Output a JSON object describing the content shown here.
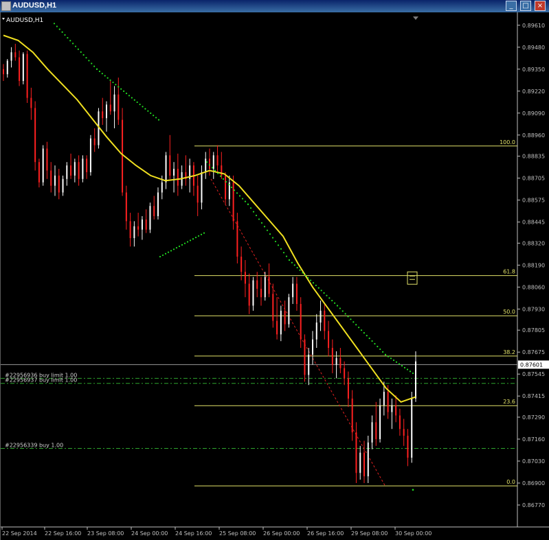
{
  "window": {
    "title": "AUDUSD,H1",
    "min_glyph": "_",
    "max_glyph": "□",
    "close_glyph": "×"
  },
  "chart_data": {
    "type": "candlestick",
    "symbol_label": "AUDUSD,H1",
    "ylim": [
      0.8664,
      0.8967
    ],
    "y_ticks": [
      "0.89610",
      "0.89480",
      "0.89350",
      "0.89220",
      "0.89090",
      "0.88960",
      "0.88835",
      "0.88705",
      "0.88575",
      "0.88445",
      "0.88320",
      "0.88190",
      "0.88060",
      "0.87930",
      "0.87805",
      "0.87675",
      "0.87545",
      "0.87415",
      "0.87290",
      "0.87160",
      "0.87030",
      "0.86900",
      "0.86770"
    ],
    "x_ticks": [
      "22 Sep 2014",
      "22 Sep 16:00",
      "23 Sep 08:00",
      "24 Sep 00:00",
      "24 Sep 16:00",
      "25 Sep 08:00",
      "26 Sep 00:00",
      "26 Sep 16:00",
      "29 Sep 08:00",
      "30 Sep 00:00"
    ],
    "current_price": "0.87601",
    "candles": [
      [
        0.8935,
        0.8938,
        0.8928,
        0.8932
      ],
      [
        0.8932,
        0.8941,
        0.893,
        0.894
      ],
      [
        0.894,
        0.8948,
        0.8936,
        0.8945
      ],
      [
        0.8945,
        0.895,
        0.894,
        0.8942
      ],
      [
        0.8942,
        0.8946,
        0.8925,
        0.8928
      ],
      [
        0.8928,
        0.8945,
        0.8926,
        0.8944
      ],
      [
        0.8944,
        0.8946,
        0.8915,
        0.8918
      ],
      [
        0.8918,
        0.8924,
        0.8905,
        0.8912
      ],
      [
        0.8912,
        0.8916,
        0.8875,
        0.888
      ],
      [
        0.888,
        0.8882,
        0.8865,
        0.8868
      ],
      [
        0.8868,
        0.889,
        0.8866,
        0.8888
      ],
      [
        0.8888,
        0.8892,
        0.887,
        0.8875
      ],
      [
        0.8875,
        0.888,
        0.8862,
        0.8866
      ],
      [
        0.8866,
        0.8878,
        0.886,
        0.8872
      ],
      [
        0.8872,
        0.8876,
        0.8858,
        0.8862
      ],
      [
        0.8862,
        0.8872,
        0.886,
        0.887
      ],
      [
        0.887,
        0.888,
        0.8866,
        0.8878
      ],
      [
        0.8878,
        0.8885,
        0.887,
        0.8872
      ],
      [
        0.8872,
        0.8882,
        0.8868,
        0.888
      ],
      [
        0.888,
        0.8884,
        0.8866,
        0.887
      ],
      [
        0.887,
        0.8884,
        0.8868,
        0.8882
      ],
      [
        0.8882,
        0.8884,
        0.887,
        0.8874
      ],
      [
        0.8874,
        0.8896,
        0.8872,
        0.8894
      ],
      [
        0.8894,
        0.89,
        0.8886,
        0.889
      ],
      [
        0.889,
        0.8912,
        0.8888,
        0.891
      ],
      [
        0.891,
        0.8918,
        0.8902,
        0.8906
      ],
      [
        0.8906,
        0.8916,
        0.8898,
        0.8914
      ],
      [
        0.8914,
        0.8928,
        0.8908,
        0.891
      ],
      [
        0.891,
        0.8925,
        0.89,
        0.892
      ],
      [
        0.892,
        0.893,
        0.8902,
        0.8905
      ],
      [
        0.8905,
        0.8912,
        0.886,
        0.8862
      ],
      [
        0.8862,
        0.8866,
        0.884,
        0.8845
      ],
      [
        0.8845,
        0.885,
        0.883,
        0.8835
      ],
      [
        0.8835,
        0.8845,
        0.883,
        0.8842
      ],
      [
        0.8842,
        0.885,
        0.8836,
        0.884
      ],
      [
        0.884,
        0.8848,
        0.8834,
        0.8846
      ],
      [
        0.8846,
        0.8852,
        0.8838,
        0.884
      ],
      [
        0.884,
        0.8856,
        0.8838,
        0.8854
      ],
      [
        0.8854,
        0.886,
        0.8846,
        0.8848
      ],
      [
        0.8848,
        0.8865,
        0.8846,
        0.8862
      ],
      [
        0.8862,
        0.8872,
        0.8858,
        0.8868
      ],
      [
        0.8868,
        0.8886,
        0.8864,
        0.8884
      ],
      [
        0.8884,
        0.8896,
        0.887,
        0.8872
      ],
      [
        0.8872,
        0.888,
        0.8862,
        0.8876
      ],
      [
        0.8876,
        0.8885,
        0.886,
        0.8866
      ],
      [
        0.8866,
        0.8878,
        0.8864,
        0.8874
      ],
      [
        0.8874,
        0.8884,
        0.8866,
        0.887
      ],
      [
        0.887,
        0.8882,
        0.8862,
        0.8878
      ],
      [
        0.8878,
        0.888,
        0.886,
        0.8866
      ],
      [
        0.8866,
        0.8872,
        0.8848,
        0.8856
      ],
      [
        0.8856,
        0.8878,
        0.8852,
        0.8874
      ],
      [
        0.8874,
        0.8886,
        0.887,
        0.8882
      ],
      [
        0.8882,
        0.8888,
        0.8872,
        0.8876
      ],
      [
        0.8876,
        0.8886,
        0.887,
        0.8884
      ],
      [
        0.8884,
        0.889,
        0.8874,
        0.8878
      ],
      [
        0.8878,
        0.8886,
        0.887,
        0.8872
      ],
      [
        0.8872,
        0.8874,
        0.8855,
        0.8858
      ],
      [
        0.8858,
        0.8872,
        0.8854,
        0.8868
      ],
      [
        0.8868,
        0.8872,
        0.884,
        0.8845
      ],
      [
        0.8845,
        0.885,
        0.882,
        0.8824
      ],
      [
        0.8824,
        0.883,
        0.881,
        0.8815
      ],
      [
        0.8815,
        0.8822,
        0.88,
        0.8808
      ],
      [
        0.8808,
        0.8814,
        0.879,
        0.8795
      ],
      [
        0.8795,
        0.8812,
        0.8792,
        0.881
      ],
      [
        0.881,
        0.8815,
        0.88,
        0.8805
      ],
      [
        0.8805,
        0.8812,
        0.8795,
        0.88
      ],
      [
        0.88,
        0.8815,
        0.8798,
        0.8812
      ],
      [
        0.8812,
        0.882,
        0.88,
        0.8802
      ],
      [
        0.8802,
        0.8808,
        0.8782,
        0.8786
      ],
      [
        0.8786,
        0.88,
        0.8775,
        0.8778
      ],
      [
        0.8778,
        0.8795,
        0.8774,
        0.8792
      ],
      [
        0.8792,
        0.8798,
        0.878,
        0.8784
      ],
      [
        0.8784,
        0.8802,
        0.8782,
        0.88
      ],
      [
        0.88,
        0.8812,
        0.8796,
        0.8808
      ],
      [
        0.8808,
        0.8812,
        0.8792,
        0.8796
      ],
      [
        0.8796,
        0.88,
        0.877,
        0.8775
      ],
      [
        0.8775,
        0.8778,
        0.875,
        0.8754
      ],
      [
        0.8754,
        0.877,
        0.8748,
        0.8766
      ],
      [
        0.8766,
        0.878,
        0.876,
        0.8775
      ],
      [
        0.8775,
        0.879,
        0.877,
        0.8785
      ],
      [
        0.8785,
        0.8798,
        0.878,
        0.8792
      ],
      [
        0.8792,
        0.8796,
        0.8775,
        0.878
      ],
      [
        0.878,
        0.8786,
        0.8765,
        0.877
      ],
      [
        0.877,
        0.8775,
        0.8755,
        0.876
      ],
      [
        0.876,
        0.8768,
        0.8752,
        0.8764
      ],
      [
        0.8764,
        0.877,
        0.8755,
        0.8758
      ],
      [
        0.8758,
        0.8762,
        0.8748,
        0.8752
      ],
      [
        0.8752,
        0.8756,
        0.8735,
        0.874
      ],
      [
        0.874,
        0.8745,
        0.8715,
        0.872
      ],
      [
        0.872,
        0.8726,
        0.869,
        0.8696
      ],
      [
        0.8696,
        0.8712,
        0.8692,
        0.8708
      ],
      [
        0.8708,
        0.8715,
        0.869,
        0.8694
      ],
      [
        0.8694,
        0.8718,
        0.869,
        0.8714
      ],
      [
        0.8714,
        0.873,
        0.871,
        0.8726
      ],
      [
        0.8726,
        0.8738,
        0.8712,
        0.8716
      ],
      [
        0.8716,
        0.874,
        0.8714,
        0.8736
      ],
      [
        0.8736,
        0.875,
        0.873,
        0.8744
      ],
      [
        0.8744,
        0.8748,
        0.8728,
        0.8732
      ],
      [
        0.8732,
        0.874,
        0.8722,
        0.8736
      ],
      [
        0.8736,
        0.8742,
        0.8726,
        0.873
      ],
      [
        0.873,
        0.8734,
        0.8718,
        0.8722
      ],
      [
        0.8722,
        0.8728,
        0.8712,
        0.8718
      ],
      [
        0.8718,
        0.8722,
        0.87,
        0.8705
      ],
      [
        0.8705,
        0.8744,
        0.8702,
        0.874
      ],
      [
        0.874,
        0.8768,
        0.8738,
        0.8762
      ]
    ],
    "sma_y": [
      0.8955,
      0.8952,
      0.8945,
      0.8935,
      0.8926,
      0.8917,
      0.8906,
      0.8895,
      0.8885,
      0.8878,
      0.8872,
      0.8869,
      0.887,
      0.8872,
      0.8875,
      0.8873,
      0.8866,
      0.8856,
      0.8846,
      0.8836,
      0.882,
      0.8806,
      0.8794,
      0.8782,
      0.877,
      0.8758,
      0.8746,
      0.8738,
      0.8741
    ],
    "trailing_stop_upper_y": [
      0.8962,
      0.8935,
      0.8905,
      0.8885,
      0.888,
      0.8855,
      0.8822,
      0.8795,
      0.8766,
      0.8755
    ],
    "trailing_stop_lower_y": [
      0.8824,
      0.8838
    ],
    "fib_levels": [
      {
        "label": "100.0",
        "price": 0.88895
      },
      {
        "label": "61.8",
        "price": 0.88128
      },
      {
        "label": "50.0",
        "price": 0.8789
      },
      {
        "label": "38.2",
        "price": 0.87652
      },
      {
        "label": "23.6",
        "price": 0.87358
      },
      {
        "label": "0.0",
        "price": 0.86883
      }
    ],
    "orders": [
      {
        "label": "#22956936 buy limit 1.00",
        "price": 0.8752
      },
      {
        "label": "#22956937 buy limit 1.00",
        "price": 0.8749
      },
      {
        "label": "#22956339 buy 1.00",
        "price": 0.87105
      }
    ],
    "trendline_start": [
      0.887,
      0.8688
    ]
  }
}
